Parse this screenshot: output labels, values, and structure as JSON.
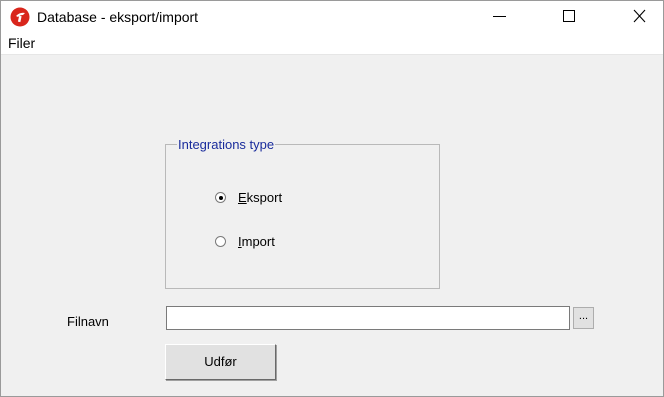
{
  "window": {
    "title": "Database - eksport/import",
    "icon": "app-logo-icon",
    "controls": [
      "minimize-icon",
      "maximize-icon",
      "close-icon"
    ]
  },
  "menu": {
    "items": [
      {
        "label": "Filer"
      }
    ]
  },
  "integration": {
    "legend": "Integrations type",
    "options": [
      {
        "label": "Eksport",
        "selected": true
      },
      {
        "label": "Import",
        "selected": false
      }
    ]
  },
  "file": {
    "label": "Filnavn",
    "value": "",
    "browse_label": "..."
  },
  "actions": {
    "execute_label": "Udfør"
  },
  "colors": {
    "legend_text": "#1a2c9c",
    "logo": "#d9261c",
    "dialog_bg": "#f0f0f0"
  }
}
